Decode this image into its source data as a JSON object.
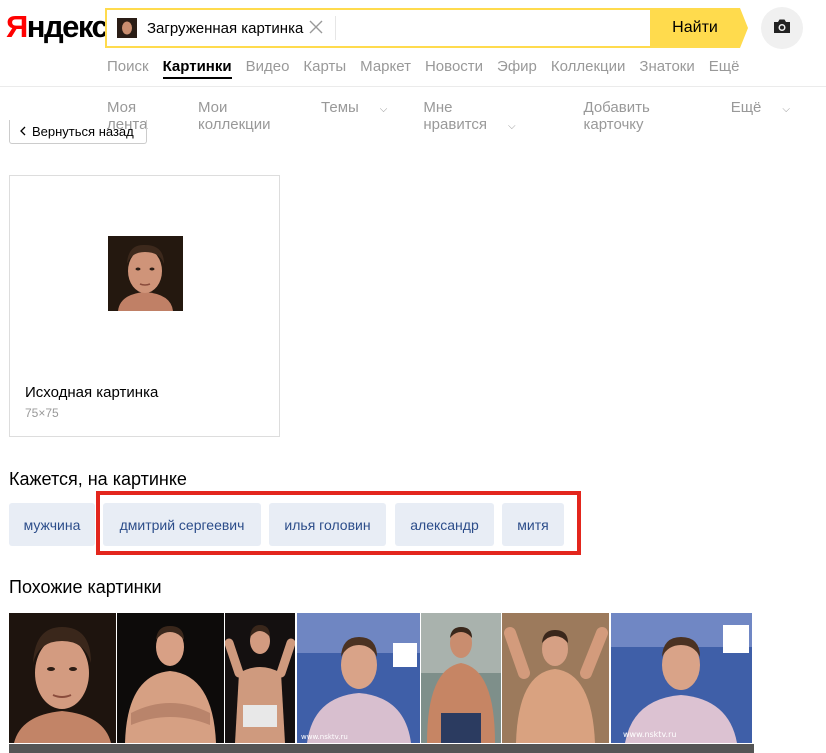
{
  "logo": {
    "first": "Я",
    "rest": "ндекс"
  },
  "search": {
    "chip_label": "Загруженная картинка",
    "find_label": "Найти"
  },
  "services": [
    "Поиск",
    "Картинки",
    "Видео",
    "Карты",
    "Маркет",
    "Новости",
    "Эфир",
    "Коллекции",
    "Знатоки",
    "Ещё"
  ],
  "services_active": "Картинки",
  "subnav": {
    "feed": "Моя лента",
    "collections": "Мои коллекции",
    "themes": "Темы",
    "likes": "Мне нравится",
    "add_card": "Добавить карточку",
    "more": "Ещё"
  },
  "back_label": "Вернуться назад",
  "source": {
    "title": "Исходная картинка",
    "size": "75×75"
  },
  "tags_heading": "Кажется, на картинке",
  "tags": [
    "мужчина",
    "дмитрий сергеевич",
    "илья головин",
    "александр",
    "митя"
  ],
  "similar_heading": "Похожие картинки",
  "watermarks": {
    "nsk": "www.nsktv.ru"
  },
  "colors": {
    "accent": "#ffdb4d",
    "highlight": "#e3261d",
    "tag_bg": "#e8edf5",
    "tag_text": "#2c4d8a"
  }
}
